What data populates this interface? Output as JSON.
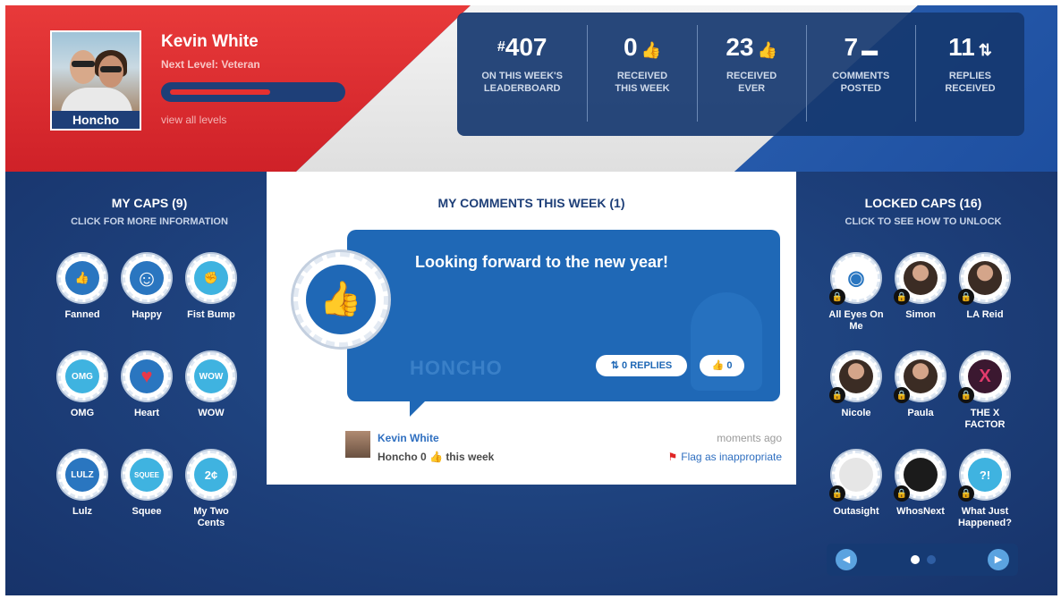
{
  "profile": {
    "name": "Kevin White",
    "next_level": "Next Level: Veteran",
    "level_badge": "Honcho",
    "view_levels_link": "view all levels",
    "level_progress_percent": 60
  },
  "stats": [
    {
      "prefix": "#",
      "value": "407",
      "icon": "",
      "label_line1": "ON THIS WEEK'S",
      "label_line2": "LEADERBOARD"
    },
    {
      "prefix": "",
      "value": "0",
      "icon": "thumbs-up-icon",
      "label_line1": "RECEIVED",
      "label_line2": "THIS WEEK"
    },
    {
      "prefix": "",
      "value": "23",
      "icon": "thumbs-up-icon",
      "label_line1": "RECEIVED",
      "label_line2": "EVER"
    },
    {
      "prefix": "",
      "value": "7",
      "icon": "comment-icon",
      "label_line1": "COMMENTS",
      "label_line2": "POSTED"
    },
    {
      "prefix": "",
      "value": "11",
      "icon": "replies-icon",
      "label_line1": "REPLIES",
      "label_line2": "RECEIVED"
    }
  ],
  "my_caps": {
    "title": "MY CAPS (9)",
    "subtitle": "CLICK FOR MORE INFORMATION",
    "items": [
      {
        "label": "Fanned",
        "glyph": "👍"
      },
      {
        "label": "Happy",
        "glyph": "☺"
      },
      {
        "label": "Fist Bump",
        "glyph": "✊"
      },
      {
        "label": "OMG",
        "glyph": "OMG"
      },
      {
        "label": "Heart",
        "glyph": "♥"
      },
      {
        "label": "WOW",
        "glyph": "WOW"
      },
      {
        "label": "Lulz",
        "glyph": "LULZ"
      },
      {
        "label": "Squee",
        "glyph": "SQUEE"
      },
      {
        "label": "My Two Cents",
        "glyph": "2¢"
      }
    ]
  },
  "locked_caps": {
    "title": "LOCKED CAPS (16)",
    "subtitle": "CLICK TO SEE HOW TO UNLOCK",
    "items": [
      {
        "label": "All Eyes On Me",
        "glyph": "◉"
      },
      {
        "label": "Simon",
        "glyph": ""
      },
      {
        "label": "LA Reid",
        "glyph": ""
      },
      {
        "label": "Nicole",
        "glyph": ""
      },
      {
        "label": "Paula",
        "glyph": ""
      },
      {
        "label": "THE X FACTOR",
        "glyph": "X"
      },
      {
        "label": "Outasight",
        "glyph": ""
      },
      {
        "label": "WhosNext",
        "glyph": ""
      },
      {
        "label": "What Just Happened?",
        "glyph": "?!"
      }
    ]
  },
  "comments": {
    "title": "MY COMMENTS THIS WEEK (1)",
    "comment_text": "Looking forward to the new year!",
    "watermark": "HONCHO",
    "replies_label": "0 REPLIES",
    "likes_label": "0",
    "author": "Kevin White",
    "author_line_prefix": "Honcho 0",
    "author_line_suffix": "this week",
    "time": "moments ago",
    "flag_label": "Flag as inappropriate"
  },
  "pager": {
    "prev": "◀",
    "next": "▶"
  },
  "colors": {
    "red": "#e02a2f",
    "navy": "#1d3f7a",
    "bubble_blue": "#1f68b6",
    "link_blue": "#2f6fc0"
  }
}
